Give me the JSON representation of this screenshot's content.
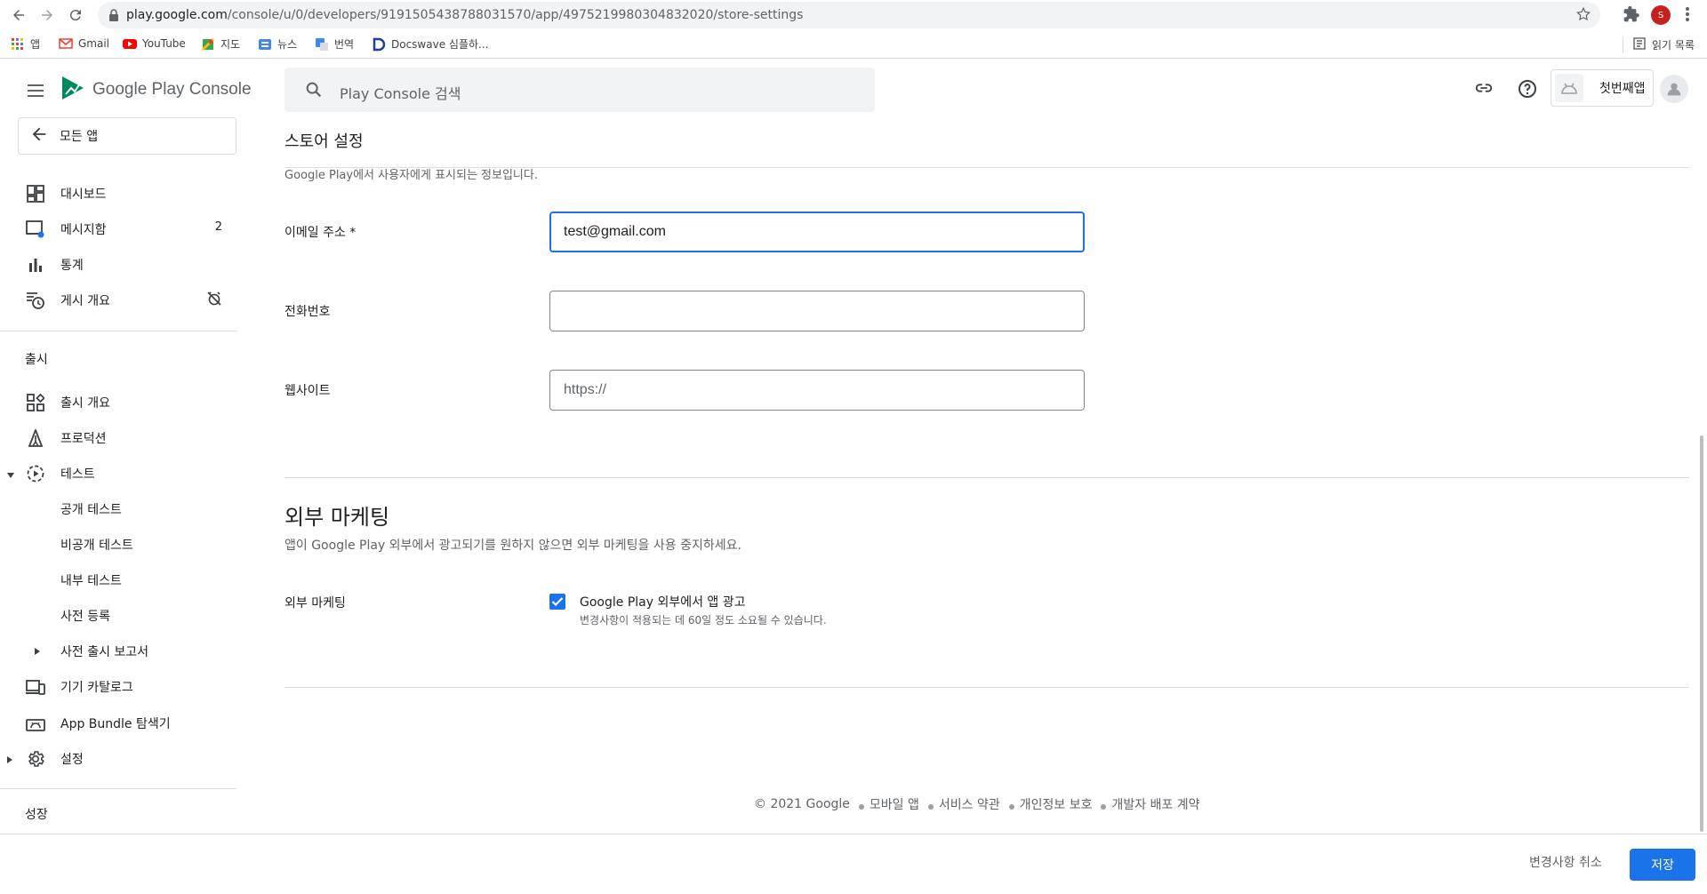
{
  "browser": {
    "url_host": "play.google.com",
    "url_path": "/console/u/0/developers/9191505438788031570/app/4975219980304832020/store-settings",
    "profile_initial": "S",
    "bookmarks": [
      "앱",
      "Gmail",
      "YouTube",
      "지도",
      "뉴스",
      "번역",
      "Docswave 심플하..."
    ],
    "reading_list": "읽기 목록"
  },
  "header": {
    "logo_google": "Google Play",
    "logo_console": "Console",
    "search_placeholder": "Play Console 검색",
    "app_name": "첫번째앱"
  },
  "sidebar": {
    "all_apps": "모든 앱",
    "items": [
      {
        "label": "대시보드"
      },
      {
        "label": "메시지함",
        "badge": "2"
      },
      {
        "label": "통계"
      },
      {
        "label": "게시 개요"
      }
    ],
    "release_section": "출시",
    "release_items": [
      {
        "label": "출시 개요"
      },
      {
        "label": "프로덕션"
      },
      {
        "label": "테스트"
      },
      {
        "label": "공개 테스트"
      },
      {
        "label": "비공개 테스트"
      },
      {
        "label": "내부 테스트"
      },
      {
        "label": "사전 등록"
      },
      {
        "label": "사전 출시 보고서"
      },
      {
        "label": "기기 카탈로그"
      },
      {
        "label": "App Bundle 탐색기"
      },
      {
        "label": "설정"
      }
    ],
    "growth_section": "성장"
  },
  "main": {
    "title": "스토어 설정",
    "subtitle": "Google Play에서 사용자에게 표시되는 정보입니다.",
    "email_label": "이메일 주소 *",
    "email_value": "test@gmail.com",
    "phone_label": "전화번호",
    "phone_value": "",
    "website_label": "웹사이트",
    "website_placeholder": "https://",
    "external_marketing": {
      "title": "외부 마케팅",
      "description": "앱이 Google Play 외부에서 광고되기를 원하지 않으면 외부 마케팅을 사용 중지하세요.",
      "label": "외부 마케팅",
      "checkbox_label": "Google Play 외부에서 앱 광고",
      "checkbox_help": "변경사항이 적용되는 데 60일 정도 소요될 수 있습니다.",
      "checked": true
    }
  },
  "footer": {
    "copyright": "© 2021 Google",
    "links": [
      "모바일 앱",
      "서비스 약관",
      "개인정보 보호",
      "개발자 배포 계약"
    ]
  },
  "actions": {
    "discard": "변경사항 취소",
    "save": "저장"
  },
  "colors": {
    "accent": "#1a73e8"
  }
}
